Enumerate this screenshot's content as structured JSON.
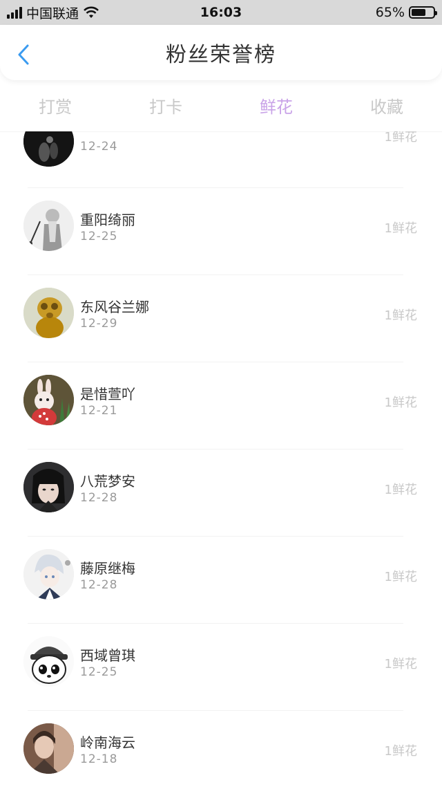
{
  "status_bar": {
    "carrier": "中国联通",
    "time": "16:03",
    "battery_percent_label": "65%",
    "battery_level": 0.65
  },
  "nav": {
    "title": "粉丝荣誉榜"
  },
  "tabs": [
    {
      "label": "打赏",
      "active": false
    },
    {
      "label": "打卡",
      "active": false
    },
    {
      "label": "鲜花",
      "active": true
    },
    {
      "label": "收藏",
      "active": false
    }
  ],
  "partial_row": {
    "date": "12-24",
    "flowers": "1鲜花"
  },
  "fans": [
    {
      "name": "重阳绮丽",
      "date": "12-25",
      "flowers": "1鲜花"
    },
    {
      "name": "东风谷兰娜",
      "date": "12-29",
      "flowers": "1鲜花"
    },
    {
      "name": "是惜萱吖",
      "date": "12-21",
      "flowers": "1鲜花"
    },
    {
      "name": "八荒梦安",
      "date": "12-28",
      "flowers": "1鲜花"
    },
    {
      "name": "藤原继梅",
      "date": "12-28",
      "flowers": "1鲜花"
    },
    {
      "name": "西域曾琪",
      "date": "12-25",
      "flowers": "1鲜花"
    },
    {
      "name": "岭南海云",
      "date": "12-18",
      "flowers": "1鲜花"
    }
  ],
  "colors": {
    "active_tab": "#c9a3e8",
    "back_arrow": "#3a9bf0"
  }
}
